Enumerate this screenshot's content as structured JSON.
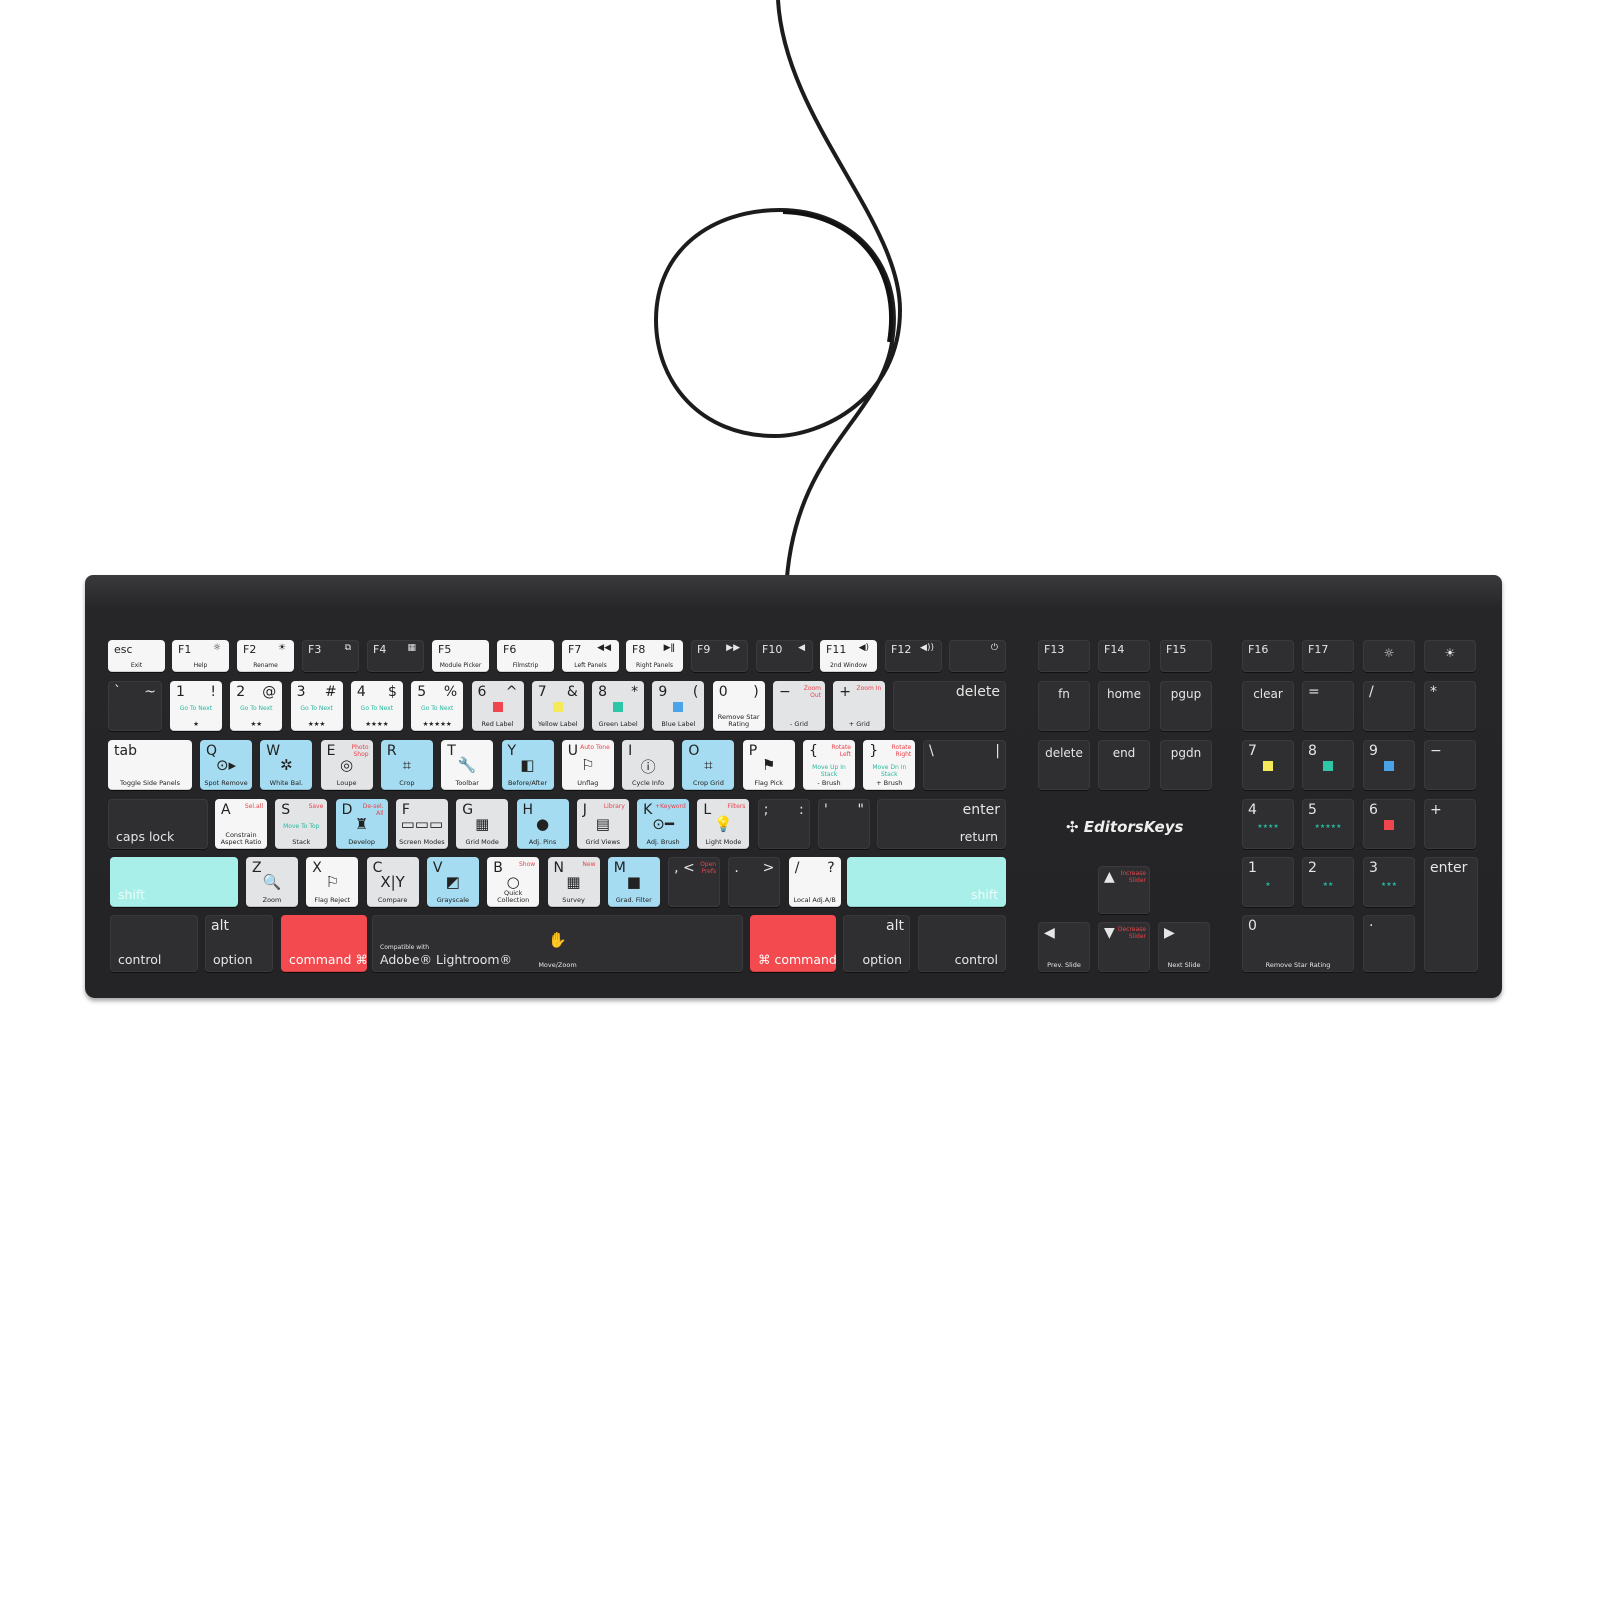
{
  "product": {
    "brand": "EditorsKeys",
    "compat": "Compatible with",
    "app": "Adobe® Lightroom®"
  },
  "colors": {
    "blue": "#a6dcf1",
    "red": "#f24a4f",
    "mint": "#a9efe9",
    "body": "#262628",
    "label_red": "#e8444c",
    "label_yellow": "#f5ea5a",
    "label_green": "#2fc6a8",
    "label_blue": "#4aa3e8"
  },
  "keys": [
    {
      "tl": "esc",
      "label": "Exit",
      "c": "white",
      "fn": 1
    },
    {
      "tl": "F1",
      "icon": "☼",
      "label": "Help",
      "c": "white",
      "fn": 1
    },
    {
      "tl": "F2",
      "icon": "☀",
      "label": "Rename",
      "c": "white",
      "fn": 1
    },
    {
      "tl": "F3",
      "icon": "⧉",
      "c": "dark",
      "fn": 1
    },
    {
      "tl": "F4",
      "icon": "▦",
      "c": "dark",
      "fn": 1
    },
    {
      "tl": "F5",
      "label": "Module Picker",
      "c": "white",
      "fn": 1
    },
    {
      "tl": "F6",
      "label": "Filmstrip",
      "c": "white",
      "fn": 1
    },
    {
      "tl": "F7",
      "icon": "◀◀",
      "label": "Left Panels",
      "c": "white",
      "fn": 1
    },
    {
      "tl": "F8",
      "icon": "▶ǁ",
      "label": "Right Panels",
      "c": "white",
      "fn": 1
    },
    {
      "tl": "F9",
      "icon": "▶▶",
      "c": "dark",
      "fn": 1
    },
    {
      "tl": "F10",
      "icon": "◀",
      "c": "dark",
      "fn": 1
    },
    {
      "tl": "F11",
      "icon": "◀)",
      "label": "2nd Window",
      "c": "white",
      "fn": 1
    },
    {
      "tl": "F12",
      "icon": "◀))",
      "c": "dark",
      "fn": 1
    },
    {
      "icon": "⏻",
      "c": "dark",
      "fn": 1
    },
    {
      "tl": "`",
      "tr": "~",
      "c": "dark"
    },
    {
      "tl": "1",
      "tr": "!",
      "green": "Go To Next",
      "label": "★",
      "c": "white"
    },
    {
      "tl": "2",
      "tr": "@",
      "green": "Go To Next",
      "label": "★★",
      "c": "white"
    },
    {
      "tl": "3",
      "tr": "#",
      "green": "Go To Next",
      "label": "★★★",
      "c": "white"
    },
    {
      "tl": "4",
      "tr": "$",
      "green": "Go To Next",
      "label": "★★★★",
      "c": "white"
    },
    {
      "tl": "5",
      "tr": "%",
      "green": "Go To Next",
      "label": "★★★★★",
      "c": "white"
    },
    {
      "tl": "6",
      "tr": "^",
      "sw": "#f0474f",
      "label": "Red Label",
      "c": "light"
    },
    {
      "tl": "7",
      "tr": "&",
      "sw": "#f5ea5a",
      "label": "Yellow Label",
      "c": "light"
    },
    {
      "tl": "8",
      "tr": "*",
      "sw": "#2fc6a8",
      "label": "Green Label",
      "c": "light"
    },
    {
      "tl": "9",
      "tr": "(",
      "sw": "#4aa3e8",
      "label": "Blue Label",
      "c": "light"
    },
    {
      "tl": "0",
      "tr": ")",
      "label": "Remove Star Rating",
      "c": "white"
    },
    {
      "tl": "−",
      "note": "Zoom Out",
      "label": "- Grid",
      "c": "light"
    },
    {
      "tl": "+",
      "note": "Zoom In",
      "label": "+ Grid",
      "c": "light"
    },
    {
      "tr": "delete",
      "c": "dark"
    },
    {
      "tl": "tab",
      "label": "Toggle Side Panels",
      "c": "white"
    },
    {
      "tl": "Q",
      "icon": "⊙▸",
      "label": "Spot Remove",
      "c": "blue"
    },
    {
      "tl": "W",
      "icon": "✲",
      "label": "White Bal.",
      "c": "blue"
    },
    {
      "tl": "E",
      "note": "Photo Shop",
      "icon": "◎",
      "label": "Loupe",
      "c": "light"
    },
    {
      "tl": "R",
      "icon": "⌗",
      "label": "Crop",
      "c": "blue"
    },
    {
      "tl": "T",
      "icon": "🔧",
      "label": "Toolbar",
      "c": "white"
    },
    {
      "tl": "Y",
      "icon": "◧",
      "label": "Before/After",
      "c": "blue"
    },
    {
      "tl": "U",
      "note": "Auto Tone",
      "icon": "⚐",
      "label": "Unflag",
      "c": "white"
    },
    {
      "tl": "I",
      "icon": "ⓘ",
      "label": "Cycle Info",
      "c": "light"
    },
    {
      "tl": "O",
      "icon": "⌗",
      "label": "Crop Grid",
      "c": "blue"
    },
    {
      "tl": "P",
      "icon": "⚑",
      "label": "Flag Pick",
      "c": "white"
    },
    {
      "tl": "{",
      "note": "Rotate Left",
      "green": "Move Up In Stack",
      "label": "- Brush",
      "c": "white"
    },
    {
      "tl": "}",
      "note": "Rotate Right",
      "green": "Move Dn In Stack",
      "label": "+ Brush",
      "c": "white"
    },
    {
      "tl": "\\",
      "tr": "|",
      "c": "dark"
    },
    {
      "bl": "caps lock",
      "c": "dark"
    },
    {
      "tl": "A",
      "note": "Sel.all",
      "label": "Constrain Aspect Ratio",
      "c": "white"
    },
    {
      "tl": "S",
      "note": "Save",
      "green": "Move To Top",
      "label": "Stack",
      "c": "light"
    },
    {
      "tl": "D",
      "note": "De-sel. All",
      "icon": "♜",
      "label": "Develop",
      "c": "blue"
    },
    {
      "tl": "F",
      "icon": "▭▭▭",
      "label": "Screen Modes",
      "c": "light"
    },
    {
      "tl": "G",
      "icon": "▦",
      "label": "Grid Mode",
      "c": "light"
    },
    {
      "tl": "H",
      "icon": "●",
      "label": "Adj. Pins",
      "c": "blue"
    },
    {
      "tl": "J",
      "note": "Library",
      "icon": "▤",
      "label": "Grid Views",
      "c": "light"
    },
    {
      "tl": "K",
      "note": "+Keyword",
      "icon": "⊙━",
      "label": "Adj. Brush",
      "c": "blue"
    },
    {
      "tl": "L",
      "note": "Filters",
      "icon": "💡",
      "label": "Light Mode",
      "c": "light"
    },
    {
      "tl": ";",
      "tr": ":",
      "c": "dark"
    },
    {
      "tl": "'",
      "tr": "\"",
      "c": "dark"
    },
    {
      "tr": "enter",
      "br": "return",
      "c": "dark"
    },
    {
      "bl": "shift",
      "c": "mint"
    },
    {
      "tl": "Z",
      "icon": "🔍",
      "label": "Zoom",
      "c": "light"
    },
    {
      "tl": "X",
      "icon": "⚐",
      "label": "Flag Reject",
      "c": "white"
    },
    {
      "tl": "C",
      "icon": "X|Y",
      "label": "Compare",
      "c": "light"
    },
    {
      "tl": "V",
      "icon": "◩",
      "label": "Grayscale",
      "c": "blue"
    },
    {
      "tl": "B",
      "note": "Show",
      "icon": "○",
      "label": "Quick Collection",
      "c": "white"
    },
    {
      "tl": "N",
      "note": "New",
      "icon": "▦",
      "label": "Survey",
      "c": "light"
    },
    {
      "tl": "M",
      "icon": "■",
      "label": "Grad. Filter",
      "c": "blue"
    },
    {
      "tl": ", <",
      "note": "Open Prefs",
      "c": "dark"
    },
    {
      "tl": ".",
      "tr": ">",
      "c": "dark"
    },
    {
      "tl": "/",
      "tr": "?",
      "label": "Local Adj.A/B",
      "c": "white"
    },
    {
      "br": "shift",
      "c": "mint"
    },
    {
      "bl": "control",
      "c": "dark"
    },
    {
      "tl": "alt",
      "bl": "option",
      "c": "dark"
    },
    {
      "bl": "command ⌘",
      "c": "red"
    },
    {
      "pre": "Compatible with",
      "bl": "Adobe® Lightroom®",
      "icon": "✋",
      "label": "Move/Zoom",
      "c": "dark"
    },
    {
      "bl": "⌘ command",
      "c": "red"
    },
    {
      "tr": "alt",
      "br": "option",
      "c": "dark"
    },
    {
      "br": "control",
      "c": "dark"
    },
    {
      "tl": "F13",
      "c": "dark",
      "fn": 1
    },
    {
      "tl": "F14",
      "c": "dark",
      "fn": 1
    },
    {
      "tl": "F15",
      "c": "dark",
      "fn": 1
    },
    {
      "tc": "fn",
      "c": "dark"
    },
    {
      "tc": "home",
      "c": "dark"
    },
    {
      "tc": "pgup",
      "c": "dark"
    },
    {
      "tc": "delete",
      "c": "dark"
    },
    {
      "tc": "end",
      "c": "dark"
    },
    {
      "tc": "pgdn",
      "c": "dark"
    },
    {
      "tl": "▲",
      "note": "Increase Slider",
      "c": "dark"
    },
    {
      "tl": "◀",
      "label": "Prev. Slide",
      "c": "dark"
    },
    {
      "tl": "▼",
      "note": "Decrease Slider",
      "c": "dark"
    },
    {
      "tl": "▶",
      "label": "Next Slide",
      "c": "dark"
    },
    {
      "tl": "F16",
      "c": "dark",
      "fn": 1
    },
    {
      "tl": "F17",
      "c": "dark",
      "fn": 1
    },
    {
      "tc": "☼",
      "c": "dark"
    },
    {
      "tc": "☀",
      "c": "dark"
    },
    {
      "tc": "clear",
      "c": "dark"
    },
    {
      "tl": "=",
      "c": "dark"
    },
    {
      "tl": "/",
      "c": "dark"
    },
    {
      "tl": "*",
      "c": "dark"
    },
    {
      "tl": "7",
      "sw": "#f5ea5a",
      "c": "dark"
    },
    {
      "tl": "8",
      "sw": "#2fc6a8",
      "c": "dark"
    },
    {
      "tl": "9",
      "sw": "#4aa3e8",
      "c": "dark"
    },
    {
      "tl": "−",
      "c": "dark"
    },
    {
      "tl": "4",
      "green": "★★★★",
      "c": "dark"
    },
    {
      "tl": "5",
      "green": "★★★★★",
      "c": "dark"
    },
    {
      "tl": "6",
      "sw": "#f0474f",
      "c": "dark"
    },
    {
      "tl": "+",
      "c": "dark"
    },
    {
      "tl": "1",
      "green": "★",
      "c": "dark"
    },
    {
      "tl": "2",
      "green": "★★",
      "c": "dark"
    },
    {
      "tl": "3",
      "green": "★★★",
      "c": "dark"
    },
    {
      "tl": "enter",
      "c": "dark"
    },
    {
      "tl": "0",
      "label": "Remove Star Rating",
      "c": "dark"
    },
    {
      "tl": "·",
      "c": "dark"
    }
  ]
}
